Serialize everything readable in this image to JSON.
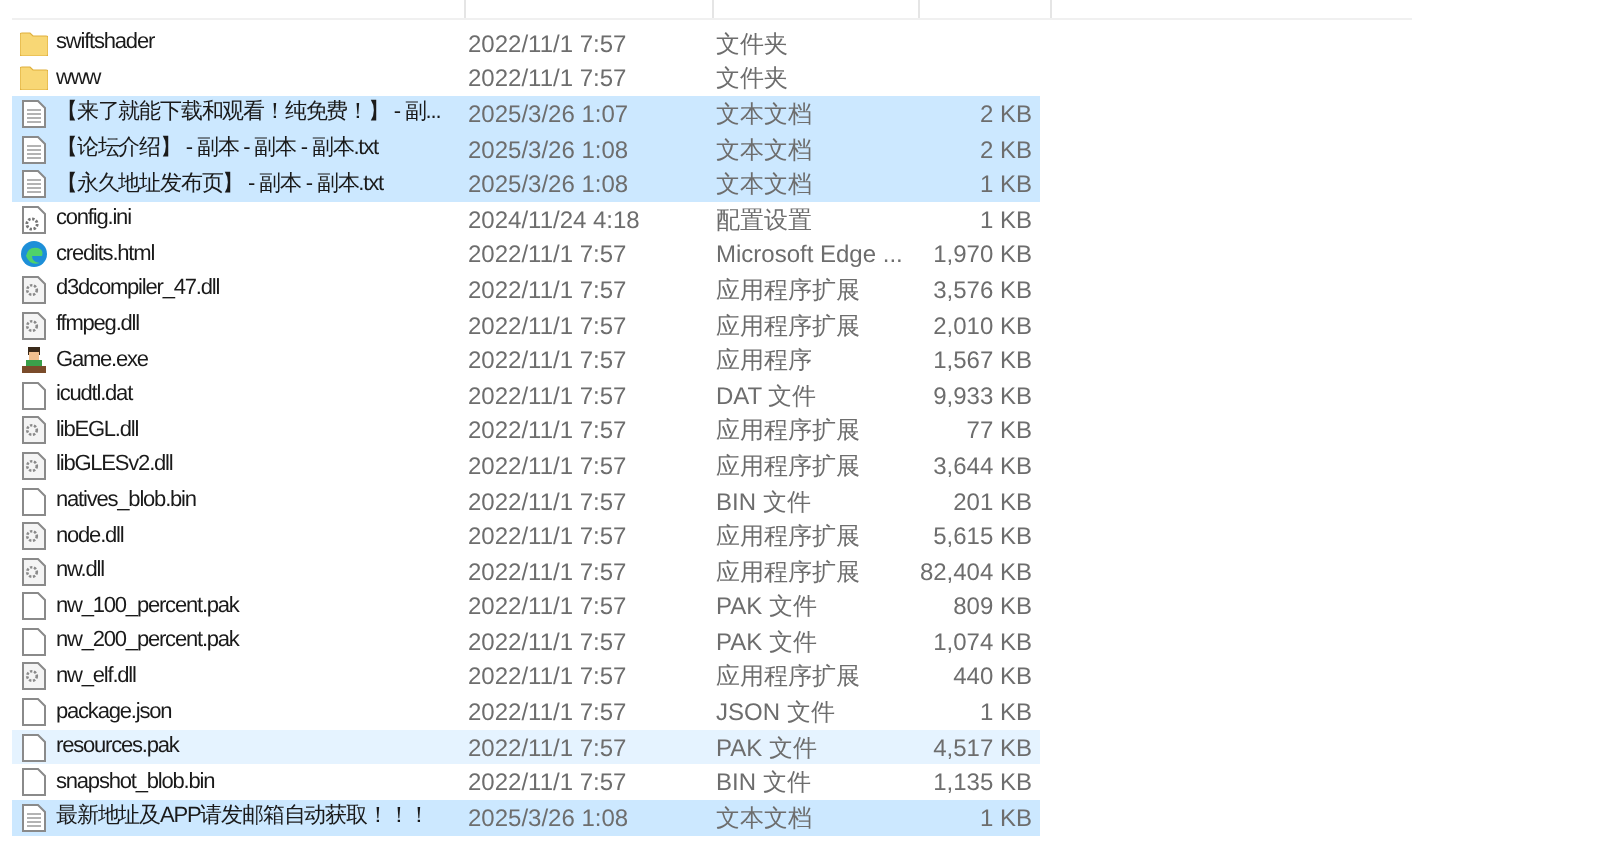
{
  "files": [
    {
      "name": "swiftshader",
      "modified": "2022/11/1 7:57",
      "type": "文件夹",
      "kind": "folder",
      "selected": false,
      "hovered": false
    },
    {
      "name": "www",
      "modified": "2022/11/1 7:57",
      "type": "文件夹",
      "kind": "folder",
      "selected": false,
      "hovered": false
    },
    {
      "name": "【来了就能下载和观看！纯免费！】 - 副...",
      "modified": "2025/3/26 1:07",
      "type": "文本文档",
      "size": "2 KB",
      "kind": "text",
      "selected": true,
      "hovered": false
    },
    {
      "name": "【论坛介绍】 - 副本 - 副本 - 副本.txt",
      "modified": "2025/3/26 1:08",
      "type": "文本文档",
      "size": "2 KB",
      "kind": "text",
      "selected": true,
      "hovered": false
    },
    {
      "name": "【永久地址发布页】 - 副本 - 副本.txt",
      "modified": "2025/3/26 1:08",
      "type": "文本文档",
      "size": "1 KB",
      "kind": "text",
      "selected": true,
      "hovered": false
    },
    {
      "name": "config.ini",
      "modified": "2024/11/24 4:18",
      "type": "配置设置",
      "size": "1 KB",
      "kind": "config",
      "selected": false,
      "hovered": false
    },
    {
      "name": "credits.html",
      "modified": "2022/11/1 7:57",
      "type": "Microsoft Edge ...",
      "size": "1,970 KB",
      "kind": "web",
      "selected": false,
      "hovered": false
    },
    {
      "name": "d3dcompiler_47.dll",
      "modified": "2022/11/1 7:57",
      "type": "应用程序扩展",
      "size": "3,576 KB",
      "kind": "dll",
      "selected": false,
      "hovered": false
    },
    {
      "name": "ffmpeg.dll",
      "modified": "2022/11/1 7:57",
      "type": "应用程序扩展",
      "size": "2,010 KB",
      "kind": "dll",
      "selected": false,
      "hovered": false
    },
    {
      "name": "Game.exe",
      "modified": "2022/11/1 7:57",
      "type": "应用程序",
      "size": "1,567 KB",
      "kind": "exe",
      "selected": false,
      "hovered": false
    },
    {
      "name": "icudtl.dat",
      "modified": "2022/11/1 7:57",
      "type": "DAT 文件",
      "size": "9,933 KB",
      "kind": "file",
      "selected": false,
      "hovered": false
    },
    {
      "name": "libEGL.dll",
      "modified": "2022/11/1 7:57",
      "type": "应用程序扩展",
      "size": "77 KB",
      "kind": "dll",
      "selected": false,
      "hovered": false
    },
    {
      "name": "libGLESv2.dll",
      "modified": "2022/11/1 7:57",
      "type": "应用程序扩展",
      "size": "3,644 KB",
      "kind": "dll",
      "selected": false,
      "hovered": false
    },
    {
      "name": "natives_blob.bin",
      "modified": "2022/11/1 7:57",
      "type": "BIN 文件",
      "size": "201 KB",
      "kind": "file",
      "selected": false,
      "hovered": false
    },
    {
      "name": "node.dll",
      "modified": "2022/11/1 7:57",
      "type": "应用程序扩展",
      "size": "5,615 KB",
      "kind": "dll",
      "selected": false,
      "hovered": false
    },
    {
      "name": "nw.dll",
      "modified": "2022/11/1 7:57",
      "type": "应用程序扩展",
      "size": "82,404 KB",
      "kind": "dll",
      "selected": false,
      "hovered": false
    },
    {
      "name": "nw_100_percent.pak",
      "modified": "2022/11/1 7:57",
      "type": "PAK 文件",
      "size": "809 KB",
      "kind": "file",
      "selected": false,
      "hovered": false
    },
    {
      "name": "nw_200_percent.pak",
      "modified": "2022/11/1 7:57",
      "type": "PAK 文件",
      "size": "1,074 KB",
      "kind": "file",
      "selected": false,
      "hovered": false
    },
    {
      "name": "nw_elf.dll",
      "modified": "2022/11/1 7:57",
      "type": "应用程序扩展",
      "size": "440 KB",
      "kind": "dll",
      "selected": false,
      "hovered": false
    },
    {
      "name": "package.json",
      "modified": "2022/11/1 7:57",
      "type": "JSON 文件",
      "size": "1 KB",
      "kind": "file",
      "selected": false,
      "hovered": false
    },
    {
      "name": "resources.pak",
      "modified": "2022/11/1 7:57",
      "type": "PAK 文件",
      "size": "4,517 KB",
      "kind": "file",
      "selected": false,
      "hovered": true
    },
    {
      "name": "snapshot_blob.bin",
      "modified": "2022/11/1 7:57",
      "type": "BIN 文件",
      "size": "1,135 KB",
      "kind": "file",
      "selected": false,
      "hovered": false
    },
    {
      "name": "最新地址及APP请发邮箱自动获取！！！",
      "modified": "2025/3/26 1:08",
      "type": "文本文档",
      "size": "1 KB",
      "kind": "text",
      "selected": true,
      "hovered": false
    }
  ]
}
